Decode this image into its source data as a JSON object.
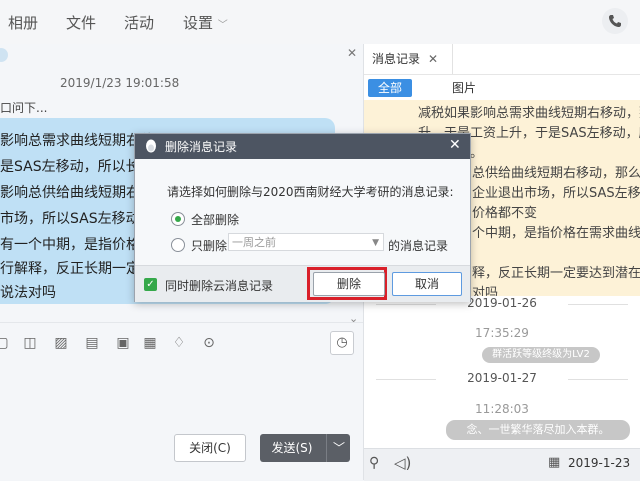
{
  "menu": {
    "album": "相册",
    "files": "文件",
    "activity": "活动",
    "settings": "设置"
  },
  "chat": {
    "timestamp": "2019/1/23 19:01:58",
    "prev_message": "口问下...",
    "bubble_lines": [
      "影响总需求曲线短期右移",
      "是SAS左移动，所以长期",
      "影响总供给曲线短期右移",
      "市场，所以SAS左移动，",
      "有一个中期，是指价格在",
      "行解释，反正长期一定要",
      "说法对吗"
    ],
    "close_button": "关闭(C)",
    "send_button": "发送(S)"
  },
  "history": {
    "tab_label": "消息记录",
    "filter_all": "全部",
    "filter_pictures": "图片",
    "message_lines": [
      "减税如果影响总需求曲线短期右移动，那么长",
      "升，于是工资上升，于是SAS左移动，所以长",
      "价格上升。",
      "总供给曲线短期右移动，那么长",
      "企业退出市场，所以SAS左移动",
      "价格都不变",
      "个中期，是指价格在需求曲线",
      "",
      "释，反正长期一定要达到潜在产",
      "对吗"
    ],
    "date1": "2019-01-26",
    "time1": "17:35:29",
    "notice1": "群活跃等级终级为LV2",
    "date2": "2019-01-27",
    "time2": "11:28:03",
    "notice2": "念、一世繁华落尽加入本群。",
    "footer_date": "2019-1-23"
  },
  "dialog": {
    "title": "删除消息记录",
    "question": "请选择如何删除与2020西南财经大学考研的消息记录:",
    "option_all": "全部删除",
    "option_only": "只删除",
    "period_value": "一周之前",
    "option_only_suffix": "的消息记录",
    "cloud_checkbox": "同时删除云消息记录",
    "delete_button": "删除",
    "cancel_button": "取消"
  },
  "colors": {
    "accent": "#3b8fe3",
    "title_bar": "#4d5562",
    "highlight": "#d9202a",
    "check": "#35a84a"
  }
}
